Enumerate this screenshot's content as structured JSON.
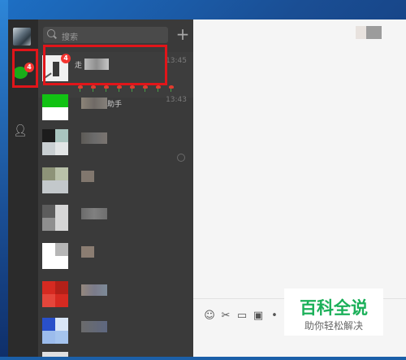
{
  "search": {
    "placeholder": "搜索"
  },
  "nav": {
    "unread_badge": "4",
    "icons": [
      "user-avatar",
      "chat-bubble-icon",
      "contacts-icon"
    ]
  },
  "chats": [
    {
      "name_visible": "走",
      "time": "13:45",
      "badge": "4",
      "preview": "tulip-emojis",
      "selected": true
    },
    {
      "name_visible": "助手",
      "time": "13:43"
    },
    {
      "name_visible": "",
      "time": "",
      "muted": true
    },
    {
      "name_visible": "",
      "time": ""
    },
    {
      "name_visible": "",
      "time": ""
    },
    {
      "name_visible": "",
      "time": ""
    },
    {
      "name_visible": "",
      "time": ""
    },
    {
      "name_visible": "",
      "time": ""
    }
  ],
  "toolbar": {
    "icons": [
      "emoji-icon",
      "scissors-icon",
      "folder-icon",
      "video-icon",
      "microphone-icon"
    ]
  },
  "watermark": {
    "title": "百科全说",
    "subtitle": "助你轻松解决"
  },
  "colors": {
    "accent_green": "#1aad19",
    "badge_red": "#f43530",
    "highlight_red": "#e1151a",
    "watermark_green": "#1bb059"
  }
}
